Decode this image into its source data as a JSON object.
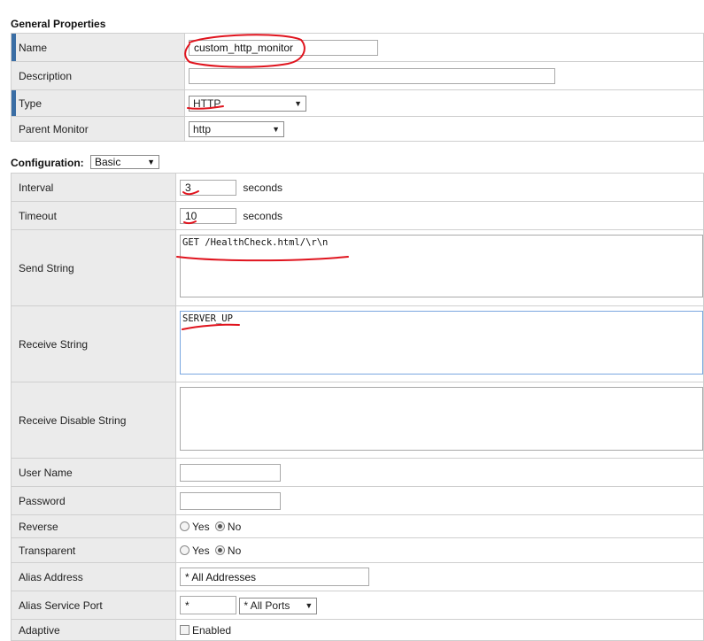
{
  "general": {
    "title": "General Properties",
    "name_label": "Name",
    "name_value": "custom_http_monitor",
    "description_label": "Description",
    "description_value": "",
    "type_label": "Type",
    "type_value": "HTTP",
    "parent_label": "Parent Monitor",
    "parent_value": "http"
  },
  "configuration": {
    "title": "Configuration:",
    "mode": "Basic",
    "interval_label": "Interval",
    "interval_value": "3",
    "timeout_label": "Timeout",
    "timeout_value": "10",
    "seconds": "seconds",
    "send_label": "Send String",
    "send_value": "GET /HealthCheck.html/\\r\\n",
    "receive_label": "Receive String",
    "receive_value": "SERVER_UP",
    "receive_disable_label": "Receive Disable String",
    "receive_disable_value": "",
    "username_label": "User Name",
    "username_value": "",
    "password_label": "Password",
    "password_value": "",
    "reverse_label": "Reverse",
    "transparent_label": "Transparent",
    "yes": "Yes",
    "no": "No",
    "alias_address_label": "Alias Address",
    "alias_address_value": "* All Addresses",
    "alias_port_label": "Alias Service Port",
    "alias_port_value": "*",
    "alias_port_select": "* All Ports",
    "adaptive_label": "Adaptive",
    "adaptive_option": "Enabled"
  },
  "colors": {
    "required_marker": "#3a6ea5",
    "label_bg": "#ebebeb",
    "annotation": "#e0141e"
  },
  "icons": {
    "dropdown": "chevron-down-icon"
  }
}
